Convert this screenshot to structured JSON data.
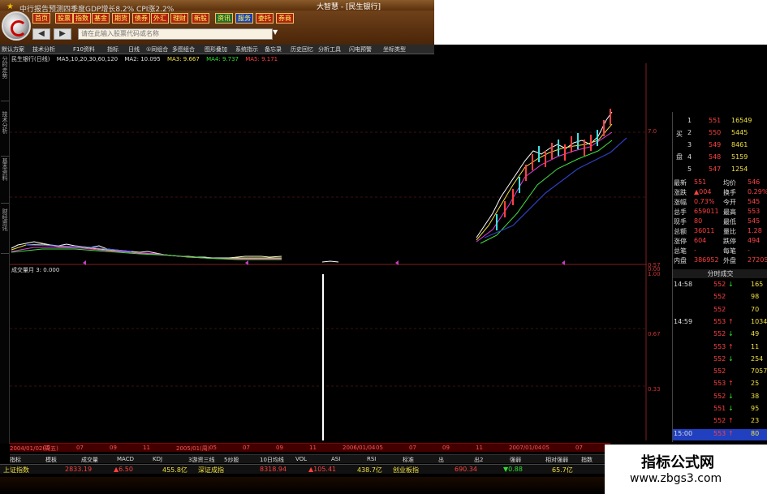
{
  "window": {
    "title": "大智慧 - [民生银行]"
  },
  "menu": [
    "首页",
    "股票",
    "指数",
    "基金",
    "期货",
    "债券",
    "外汇",
    "理财",
    "新股",
    "资讯",
    "服务",
    "委托",
    "券商"
  ],
  "search": {
    "placeholder": "请在此输入股票代码或名称",
    "nav_back": "◀",
    "nav_fwd": "▶",
    "dropdown": "▼"
  },
  "toolbar": [
    "默认方案",
    "技术分析",
    "F10资料",
    "指标",
    "日线",
    "①同组合",
    "多图组合",
    "图形叠加",
    "系统指示",
    "备忘录",
    "历史回忆",
    "分析工具",
    "闪电预警",
    "坐标类型"
  ],
  "left_tabs": [
    "分时走势",
    "技术分析",
    "基本资料",
    "财经资讯"
  ],
  "info_line": {
    "stock": "民生银行(日线)",
    "ma_label": "MA5,10,20,30,60,120",
    "ma2": "MA2: 10.095",
    "ma3": "MA3: 9.667",
    "ma4": "MA4: 9.737",
    "ma5": "MA5: 9.171"
  },
  "indicator": {
    "title": "成交量月 3: 0.000"
  },
  "axis_labels": [
    "7.0",
    "0.57",
    "0.00",
    "1.00",
    "0.67",
    "0.33"
  ],
  "orderbook": {
    "sell_label": "卖",
    "buy_label": "买",
    "plate_label": "盘",
    "rows": [
      {
        "n": "1",
        "price": "551",
        "vol": "16549"
      },
      {
        "n": "2",
        "price": "550",
        "vol": "5445"
      },
      {
        "n": "3",
        "price": "549",
        "vol": "8461"
      },
      {
        "n": "4",
        "price": "548",
        "vol": "5159"
      },
      {
        "n": "5",
        "price": "547",
        "vol": "1254"
      }
    ]
  },
  "stats": [
    {
      "l": "最新",
      "v": "551",
      "l2": "均价",
      "v2": "546"
    },
    {
      "l": "涨跌",
      "v": "▲004",
      "l2": "换手",
      "v2": "0.29%"
    },
    {
      "l": "涨幅",
      "v": "0.73%",
      "l2": "今开",
      "v2": "545"
    },
    {
      "l": "总手",
      "v": "659011",
      "l2": "最高",
      "v2": "553"
    },
    {
      "l": "现手",
      "v": "80",
      "l2": "最低",
      "v2": "545"
    },
    {
      "l": "总额",
      "v": "36011",
      "l2": "量比",
      "v2": "1.28"
    },
    {
      "l": "涨停",
      "v": "604",
      "l2": "跌停",
      "v2": "494"
    },
    {
      "l": "总笔",
      "v": "-",
      "l2": "每笔",
      "v2": "-"
    },
    {
      "l": "内盘",
      "v": "386952",
      "l2": "外盘",
      "v2": "272059"
    }
  ],
  "trades_header": "分时成交",
  "trades": [
    {
      "t": "14:58",
      "p": "552",
      "d": "↓",
      "v": "165"
    },
    {
      "t": "",
      "p": "552",
      "d": "",
      "v": "98"
    },
    {
      "t": "",
      "p": "552",
      "d": "",
      "v": "70"
    },
    {
      "t": "14:59",
      "p": "553",
      "d": "↑",
      "v": "1034"
    },
    {
      "t": "",
      "p": "552",
      "d": "↓",
      "v": "49"
    },
    {
      "t": "",
      "p": "553",
      "d": "↑",
      "v": "11"
    },
    {
      "t": "",
      "p": "552",
      "d": "↓",
      "v": "254"
    },
    {
      "t": "",
      "p": "552",
      "d": "",
      "v": "7057"
    },
    {
      "t": "",
      "p": "553",
      "d": "↑",
      "v": "25"
    },
    {
      "t": "",
      "p": "552",
      "d": "↓",
      "v": "38"
    },
    {
      "t": "",
      "p": "551",
      "d": "↓",
      "v": "95"
    },
    {
      "t": "",
      "p": "552",
      "d": "↑",
      "v": "23"
    },
    {
      "t": "15:00",
      "p": "553",
      "d": "↑",
      "v": "80"
    }
  ],
  "dates": [
    "2004/01/02(周五)",
    "05",
    "07",
    "09",
    "11",
    "2005/01(周)",
    "05",
    "07",
    "09",
    "11",
    "2006/01/04",
    "05",
    "07",
    "09",
    "11",
    "2007/01/04",
    "05",
    "07"
  ],
  "tabs": [
    "指标",
    "模板",
    "成交量",
    "MACD",
    "KDJ",
    "3游资三线",
    "5炒股",
    "10日均线",
    "VOL",
    "ASI",
    "RSI",
    "标准",
    "出",
    "出2",
    "强弱",
    "相对强弱",
    "指数"
  ],
  "index_row": [
    {
      "n": "上证指数",
      "v": "2833.19",
      "c": "▲6.50",
      "a": "455.8亿"
    },
    {
      "n": "深证成指",
      "v": "8318.94",
      "c": "▲105.41",
      "a": "438.7亿"
    },
    {
      "n": "创业板指",
      "v": "690.34",
      "c": "▼0.88",
      "a": "65.7亿"
    }
  ],
  "ticker": "中行报告预测四季度GDP增长8.2% CPI涨2.2%",
  "watermark": {
    "line1": "指标公式网",
    "line2": "www.zbgs3.com"
  }
}
